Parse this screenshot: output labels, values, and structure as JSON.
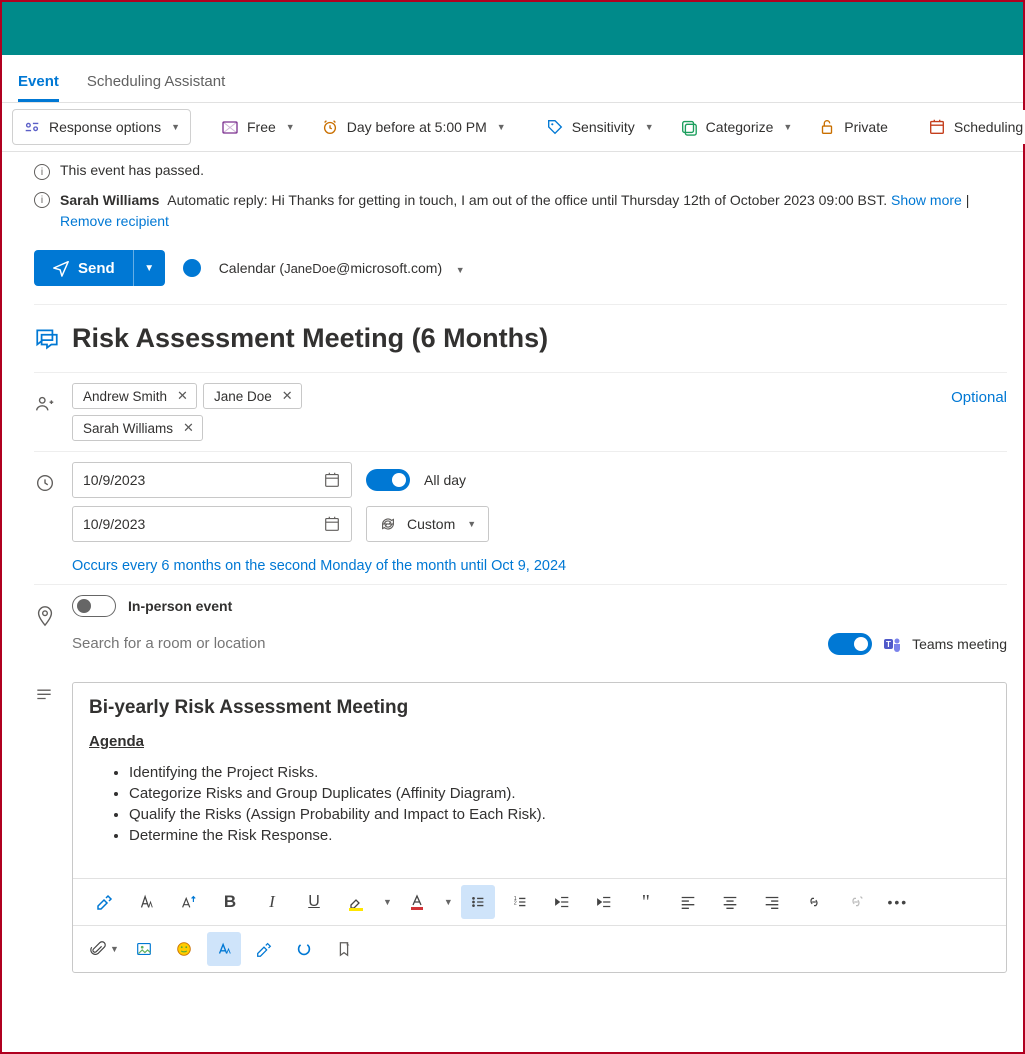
{
  "tabs": {
    "event": "Event",
    "scheduling_assistant": "Scheduling Assistant"
  },
  "toolbar": {
    "response_options": "Response options",
    "busy_status": "Free",
    "reminder": "Day before at 5:00 PM",
    "sensitivity": "Sensitivity",
    "categorize": "Categorize",
    "private": "Private",
    "scheduling": "Scheduling"
  },
  "banners": {
    "passed": "This event has passed.",
    "auto_reply_name": "Sarah Williams",
    "auto_reply_text": "Automatic reply: Hi Thanks for getting in touch, I am out of the office until Thursday 12th of October 2023 09:00 BST.",
    "show_more": "Show more",
    "remove_recipient": "Remove recipient"
  },
  "send": {
    "label": "Send"
  },
  "calendar": {
    "prefix": "Calendar (",
    "user": "JaneDoe",
    "suffix": "@microsoft.com)"
  },
  "title": "Risk Assessment Meeting (6 Months)",
  "attendees": {
    "required": [
      "Andrew Smith",
      "Jane Doe"
    ],
    "optional_row": [
      "Sarah Williams"
    ],
    "optional_label": "Optional"
  },
  "dates": {
    "start": "10/9/2023",
    "end": "10/9/2023"
  },
  "all_day": "All day",
  "recurrence_label": "Custom",
  "recurrence_text": "Occurs every 6 months on the second Monday of the month until Oct 9, 2024",
  "inperson": "In-person event",
  "location_placeholder": "Search for a room or location",
  "teams": "Teams meeting",
  "body": {
    "heading": "Bi-yearly Risk Assessment Meeting",
    "agenda_label": "Agenda",
    "items": [
      "Identifying the Project Risks.",
      "Categorize Risks and Group Duplicates (Affinity Diagram).",
      "Qualify the Risks (Assign Probability and Impact to Each Risk).",
      "Determine the Risk Response."
    ]
  }
}
